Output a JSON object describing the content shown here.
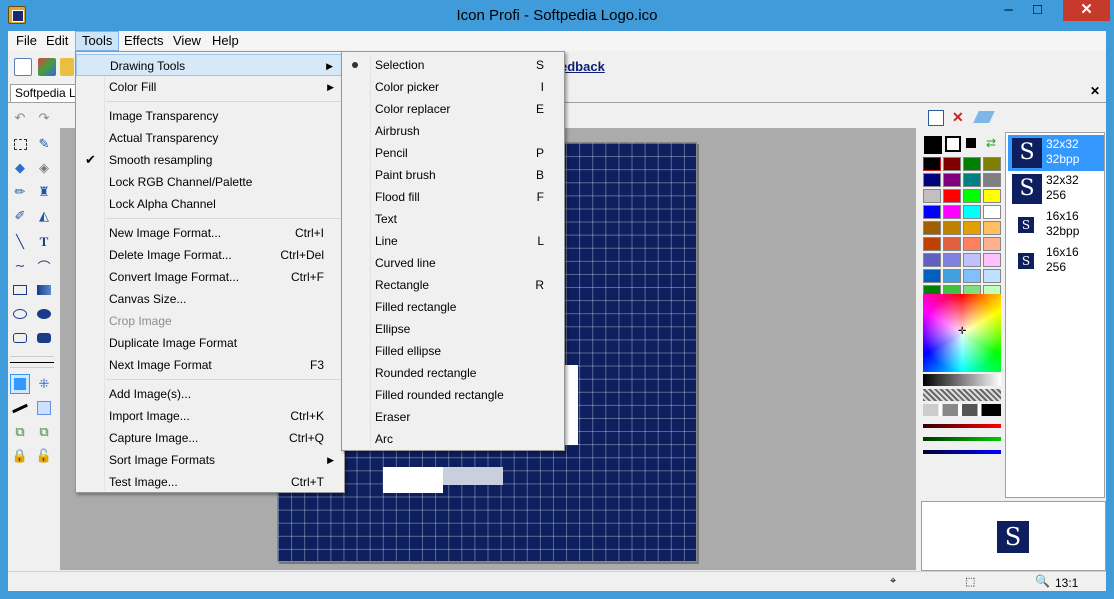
{
  "window": {
    "title": "Icon Profi - Softpedia Logo.ico",
    "min": "–",
    "max": "□",
    "close": "✕"
  },
  "menubar": [
    "File",
    "Edit",
    "Tools",
    "Effects",
    "View",
    "Help"
  ],
  "toolbar": {
    "feedback_link": "edback"
  },
  "document_tab": {
    "label": "Softpedia Lo",
    "close": "✕"
  },
  "tools_menu": {
    "items": [
      {
        "label": "Drawing Tools",
        "shortcut": "",
        "submenu": true,
        "highlighted": true
      },
      {
        "label": "Color Fill",
        "shortcut": "",
        "submenu": true
      },
      {
        "separator": true
      },
      {
        "label": "Image Transparency",
        "shortcut": ""
      },
      {
        "label": "Actual Transparency",
        "shortcut": ""
      },
      {
        "label": "Smooth resampling",
        "shortcut": "",
        "checked": true
      },
      {
        "label": "Lock RGB Channel/Palette",
        "shortcut": ""
      },
      {
        "label": "Lock Alpha Channel",
        "shortcut": ""
      },
      {
        "separator": true
      },
      {
        "label": "New Image Format...",
        "shortcut": "Ctrl+I"
      },
      {
        "label": "Delete Image Format...",
        "shortcut": "Ctrl+Del"
      },
      {
        "label": "Convert Image Format...",
        "shortcut": "Ctrl+F"
      },
      {
        "label": "Canvas Size...",
        "shortcut": ""
      },
      {
        "label": "Crop Image",
        "shortcut": "",
        "disabled": true
      },
      {
        "label": "Duplicate Image Format",
        "shortcut": ""
      },
      {
        "label": "Next Image Format",
        "shortcut": "F3"
      },
      {
        "separator": true
      },
      {
        "label": "Add  Image(s)...",
        "shortcut": ""
      },
      {
        "label": "Import Image...",
        "shortcut": "Ctrl+K"
      },
      {
        "label": "Capture Image...",
        "shortcut": "Ctrl+Q"
      },
      {
        "label": "Sort Image Formats",
        "shortcut": "",
        "submenu": true
      },
      {
        "label": "Test Image...",
        "shortcut": "Ctrl+T"
      }
    ]
  },
  "drawing_tools_menu": {
    "items": [
      {
        "label": "Selection",
        "shortcut": "S",
        "selected": true
      },
      {
        "label": "Color picker",
        "shortcut": "I"
      },
      {
        "label": "Color replacer",
        "shortcut": "E"
      },
      {
        "label": "Airbrush",
        "shortcut": ""
      },
      {
        "label": "Pencil",
        "shortcut": "P"
      },
      {
        "label": "Paint brush",
        "shortcut": "B"
      },
      {
        "label": "Flood fill",
        "shortcut": "F"
      },
      {
        "label": "Text",
        "shortcut": ""
      },
      {
        "label": "Line",
        "shortcut": "L"
      },
      {
        "label": "Curved line",
        "shortcut": ""
      },
      {
        "label": "Rectangle",
        "shortcut": "R"
      },
      {
        "label": "Filled rectangle",
        "shortcut": ""
      },
      {
        "label": "Ellipse",
        "shortcut": ""
      },
      {
        "label": "Filled ellipse",
        "shortcut": ""
      },
      {
        "label": "Rounded rectangle",
        "shortcut": ""
      },
      {
        "label": "Filled rounded rectangle",
        "shortcut": ""
      },
      {
        "label": "Eraser",
        "shortcut": ""
      },
      {
        "label": "Arc",
        "shortcut": ""
      }
    ]
  },
  "image_formats": [
    {
      "size": "32x32",
      "depth": "32bpp",
      "selected": true
    },
    {
      "size": "32x32",
      "depth": "256"
    },
    {
      "size": "16x16",
      "depth": "32bpp"
    },
    {
      "size": "16x16",
      "depth": "256"
    }
  ],
  "format_glyph": "S",
  "palette": [
    "#000000",
    "#800000",
    "#008000",
    "#808000",
    "#000080",
    "#800080",
    "#008080",
    "#808080",
    "#c0c0c0",
    "#ff0000",
    "#00ff00",
    "#ffff00",
    "#0000ff",
    "#ff00ff",
    "#00ffff",
    "#ffffff",
    "#a06000",
    "#c08000",
    "#e0a000",
    "#ffc060",
    "#c04000",
    "#e06040",
    "#ff8060",
    "#ffb090",
    "#6060c0",
    "#8080e0",
    "#c0c0ff",
    "#ffc0ff",
    "#0060c0",
    "#40a0e0",
    "#80c0ff",
    "#c0e0ff",
    "#008000",
    "#40c040",
    "#80e080",
    "#c0ffc0"
  ],
  "status": {
    "zoom": "13:1"
  }
}
